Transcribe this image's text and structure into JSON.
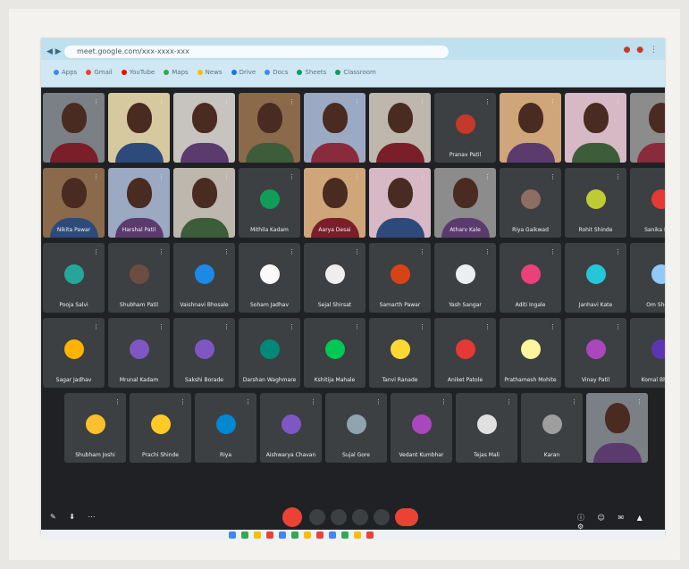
{
  "browser": {
    "url": "meet.google.com/xxx-xxxx-xxx",
    "bookmarks": [
      "Apps",
      "Gmail",
      "YouTube",
      "Maps",
      "News",
      "Drive",
      "Docs",
      "Sheets",
      "Classroom"
    ]
  },
  "meeting": {
    "row1": [
      {
        "type": "video",
        "name": ""
      },
      {
        "type": "video",
        "name": ""
      },
      {
        "type": "video",
        "name": ""
      },
      {
        "type": "video",
        "name": ""
      },
      {
        "type": "video",
        "name": ""
      },
      {
        "type": "video",
        "name": ""
      },
      {
        "type": "avatar",
        "name": "Pranav Patil",
        "color": "#c53929"
      },
      {
        "type": "video",
        "name": ""
      },
      {
        "type": "video",
        "name": ""
      },
      {
        "type": "video",
        "name": ""
      }
    ],
    "row2": [
      {
        "type": "video",
        "name": "Nikita Pawar"
      },
      {
        "type": "video",
        "name": "Harshal Patil"
      },
      {
        "type": "video",
        "name": ""
      },
      {
        "type": "avatar",
        "name": "Mithila Kadam",
        "color": "#0f9d58"
      },
      {
        "type": "video",
        "name": "Aarya Desai"
      },
      {
        "type": "video",
        "name": ""
      },
      {
        "type": "video",
        "name": "Atharv Kale"
      },
      {
        "type": "avatar",
        "name": "Riya Gaikwad",
        "color": "#8d6e63"
      },
      {
        "type": "avatar",
        "name": "Rohit Shinde",
        "color": "#c0ca33"
      },
      {
        "type": "avatar",
        "name": "Sanika More",
        "color": "#e53935"
      }
    ],
    "row3": [
      {
        "type": "avatar",
        "name": "Pooja Salvi",
        "color": "#26a69a"
      },
      {
        "type": "avatar",
        "name": "Shubham Patil",
        "color": "#6d4c41"
      },
      {
        "type": "avatar",
        "name": "Vaishnavi Bhosale",
        "color": "#1e88e5"
      },
      {
        "type": "avatar",
        "name": "Soham Jadhav",
        "color": "#fafafa"
      },
      {
        "type": "avatar",
        "name": "Sejal Shirsat",
        "color": "#eeeeee"
      },
      {
        "type": "avatar",
        "name": "Samarth Pawar",
        "color": "#d84315"
      },
      {
        "type": "avatar",
        "name": "Yash Sangar",
        "color": "#eceff1"
      },
      {
        "type": "avatar",
        "name": "Aditi Ingale",
        "color": "#ec407a"
      },
      {
        "type": "avatar",
        "name": "Janhavi Kate",
        "color": "#26c6da"
      },
      {
        "type": "avatar",
        "name": "Om Shelke",
        "color": "#90caf9"
      }
    ],
    "row4": [
      {
        "type": "avatar",
        "name": "Sagar Jadhav",
        "color": "#ffb300"
      },
      {
        "type": "avatar",
        "name": "Mrunal Kadam",
        "color": "#7e57c2"
      },
      {
        "type": "avatar",
        "name": "Sakshi Borade",
        "color": "#7e57c2"
      },
      {
        "type": "avatar",
        "name": "Darshan Waghmare",
        "color": "#00897b"
      },
      {
        "type": "avatar",
        "name": "Kshitija Mahale",
        "color": "#00c853"
      },
      {
        "type": "avatar",
        "name": "Tanvi Ranade",
        "color": "#fdd835"
      },
      {
        "type": "avatar",
        "name": "Aniket Patole",
        "color": "#e53935"
      },
      {
        "type": "avatar",
        "name": "Prathamesh Mohite",
        "color": "#fff59d"
      },
      {
        "type": "avatar",
        "name": "Vinay Patil",
        "color": "#ab47bc"
      },
      {
        "type": "avatar",
        "name": "Komal Bhamre",
        "color": "#5e35b1"
      }
    ],
    "row5": [
      {
        "type": "avatar",
        "name": "Shubham Joshi",
        "color": "#fbc02d"
      },
      {
        "type": "avatar",
        "name": "Prachi Shinde",
        "color": "#ffca28"
      },
      {
        "type": "avatar",
        "name": "Riya",
        "color": "#0288d1"
      },
      {
        "type": "avatar",
        "name": "Aishwarya Chavan",
        "color": "#7e57c2"
      },
      {
        "type": "avatar",
        "name": "Sujal Gore",
        "color": "#90a4ae"
      },
      {
        "type": "avatar",
        "name": "Vedant Kumbhar",
        "color": "#ab47bc"
      },
      {
        "type": "avatar",
        "name": "Tejas Mali",
        "color": "#e0e0e0"
      },
      {
        "type": "avatar",
        "name": "Karan",
        "color": "#9e9e9e"
      },
      {
        "type": "video",
        "name": ""
      }
    ]
  },
  "taskbar_colors": [
    "#4285f4",
    "#34a853",
    "#fbbc04",
    "#ea4335",
    "#4285f4",
    "#34a853",
    "#fbbc04",
    "#ea4335",
    "#4285f4",
    "#34a853",
    "#fbbc04",
    "#ea4335"
  ]
}
